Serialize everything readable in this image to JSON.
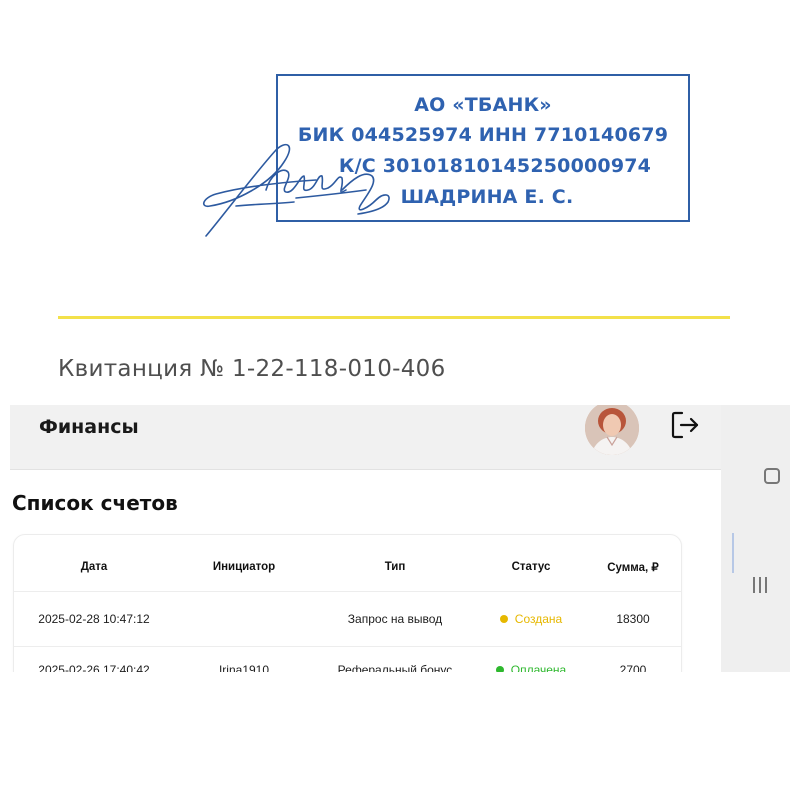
{
  "receipt": {
    "stamp": {
      "line1": "АО «ТБАНК»",
      "line2": "БИК 044525974 ИНН 7710140679",
      "line3": "К/С 30101810145250000974",
      "line4": "ШАДРИНА Е. С."
    },
    "title": "Квитанция  № 1-22-118-010-406",
    "colors": {
      "stamp": "#2f62b0",
      "rule": "#f3e14a"
    }
  },
  "app": {
    "header": {
      "title": "Финансы",
      "avatar_icon": "user-photo",
      "logout_icon": "logout-icon"
    },
    "heading": "Список счетов",
    "table": {
      "columns": {
        "date": "Дата",
        "initiator": "Инициатор",
        "type": "Тип",
        "status": "Статус",
        "sum": "Сумма, ₽"
      },
      "rows": [
        {
          "date": "2025-02-28 10:47:12",
          "initiator": "",
          "type": "Запрос на вывод",
          "status": "Создана",
          "status_color": "#e6b800",
          "sum": "18300"
        },
        {
          "date": "2025-02-26 17:40:42",
          "initiator": "Irina1910",
          "type": "Реферальный бонус",
          "status": "Оплачена",
          "status_color": "#2eb82e",
          "sum": "2700"
        }
      ]
    }
  }
}
